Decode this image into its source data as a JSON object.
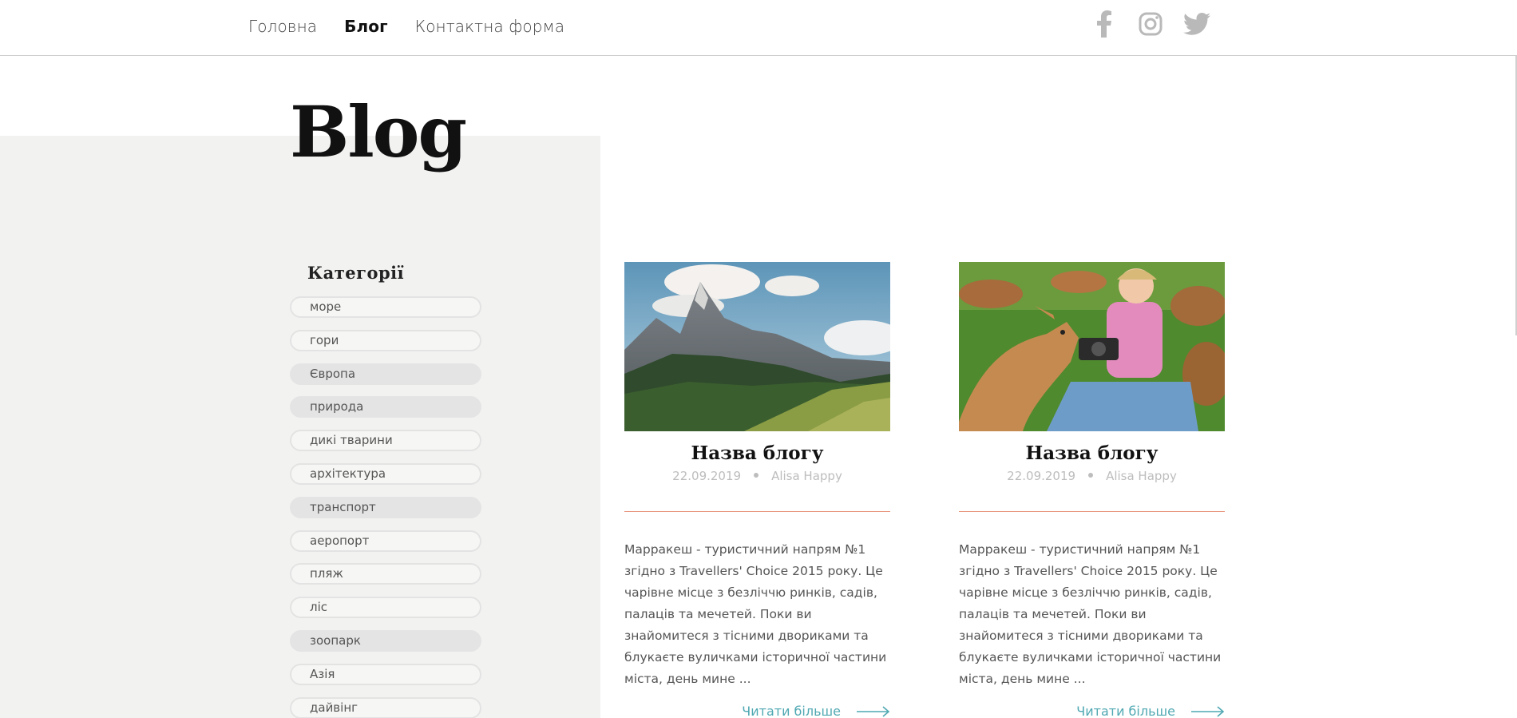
{
  "nav": {
    "items": [
      {
        "label": "Головна"
      },
      {
        "label": "Блог"
      },
      {
        "label": "Контактна форма"
      }
    ],
    "active": "Блог"
  },
  "social": [
    "facebook-icon",
    "instagram-icon",
    "twitter-icon"
  ],
  "page": {
    "title": "Blog"
  },
  "categories": {
    "heading": "Категорії",
    "items": [
      {
        "label": "море"
      },
      {
        "label": "гори"
      },
      {
        "label": "Європа"
      },
      {
        "label": "природа"
      },
      {
        "label": "дикі тварини"
      },
      {
        "label": "архітектура"
      },
      {
        "label": "транспорт"
      },
      {
        "label": "аеропорт"
      },
      {
        "label": "пляж"
      },
      {
        "label": "ліс"
      },
      {
        "label": "зоопарк"
      },
      {
        "label": "Азія"
      },
      {
        "label": "дайвінг"
      }
    ]
  },
  "posts": [
    {
      "title": "Назва блогу",
      "date": "22.09.2019",
      "author": "Alisa Happy",
      "excerpt": "Марракеш - туристичний напрям №1 згідно з Travellers' Choice 2015 року. Це чарівне місце з безліччю ринків, садів, палаців та мечетей. Поки ви знайомитеся з тісними двориками та блукаєте вуличками історичної частини міста, день мине ...",
      "read_more": "Читати більше"
    },
    {
      "title": "Назва блогу",
      "date": "22.09.2019",
      "author": "Alisa Happy",
      "excerpt": "Марракеш - туристичний напрям №1 згідно з Travellers' Choice 2015 року. Це чарівне місце з безліччю ринків, садів, палаців та мечетей. Поки ви знайомитеся з тісними двориками та блукаєте вуличками історичної частини міста, день мине ...",
      "read_more": "Читати більше"
    }
  ],
  "colors": {
    "accent_line": "#e8937a",
    "link": "#4fa8b2",
    "sidebar_bg": "#f2f3f1",
    "social_icon": "#b9b9b9"
  }
}
